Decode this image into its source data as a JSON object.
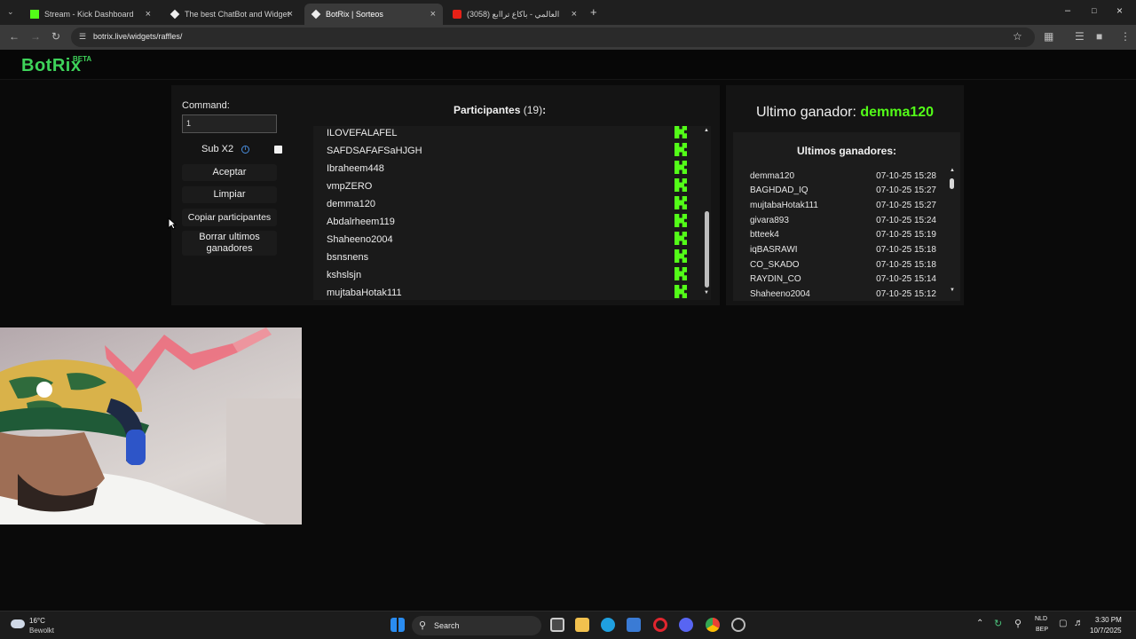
{
  "browser": {
    "tabs": [
      {
        "title": "Stream - Kick Dashboard",
        "icon": "kick-icon"
      },
      {
        "title": "The best ChatBot and Widgets",
        "icon": "botrix-icon"
      },
      {
        "title": "BotRix | Sorteos",
        "icon": "botrix-icon",
        "active": true
      },
      {
        "title": "(3058) العالمي - باكاع تراابع",
        "icon": "youtube-icon"
      }
    ],
    "url": "botrix.live/widgets/raffles/"
  },
  "site": {
    "logo": "BotRix",
    "beta": "BETA"
  },
  "raffle": {
    "command_label": "Command:",
    "command_value": "1",
    "sub_x2_label": "Sub X2",
    "sub_x2_checked": false,
    "accept_label": "Aceptar",
    "clear_label": "Limpiar",
    "copy_label": "Copiar participantes",
    "delete_winners_label": "Borrar ultimos ganadores",
    "participants_title": "Participantes",
    "participants_count": "(19)",
    "participants_colon": ":",
    "participants": [
      "ILOVEFALAFEL",
      "SAFDSAFAFSaHJGH",
      "Ibraheem448",
      "vmpZERO",
      "demma120",
      "Abdalrheem119",
      "Shaheeno2004",
      "bsnsnens",
      "kshslsjn",
      "mujtabaHotak111"
    ]
  },
  "winners": {
    "last_winner_label": "Ultimo ganador:",
    "last_winner_name": "demma120",
    "list_title": "Ultimos ganadores:",
    "list": [
      {
        "name": "demma120",
        "date": "07-10-25 15:28"
      },
      {
        "name": "BAGHDAD_IQ",
        "date": "07-10-25 15:27"
      },
      {
        "name": "mujtabaHotak111",
        "date": "07-10-25 15:27"
      },
      {
        "name": "givara893",
        "date": "07-10-25 15:24"
      },
      {
        "name": "btteek4",
        "date": "07-10-25 15:19"
      },
      {
        "name": "iqBASRAWI",
        "date": "07-10-25 15:18"
      },
      {
        "name": "CO_SKADO",
        "date": "07-10-25 15:18"
      },
      {
        "name": "RAYDIN_CO",
        "date": "07-10-25 15:14"
      },
      {
        "name": "Shaheeno2004",
        "date": "07-10-25 15:12"
      }
    ]
  },
  "taskbar": {
    "weather_temp": "16°C",
    "weather_desc": "Bewolkt",
    "search_placeholder": "Search",
    "lang_line1": "NLD",
    "lang_line2": "BEP",
    "time": "3:30 PM",
    "date": "10/7/2025"
  },
  "colors": {
    "brand_green": "#3ed35a",
    "kick_green": "#53fc18"
  }
}
